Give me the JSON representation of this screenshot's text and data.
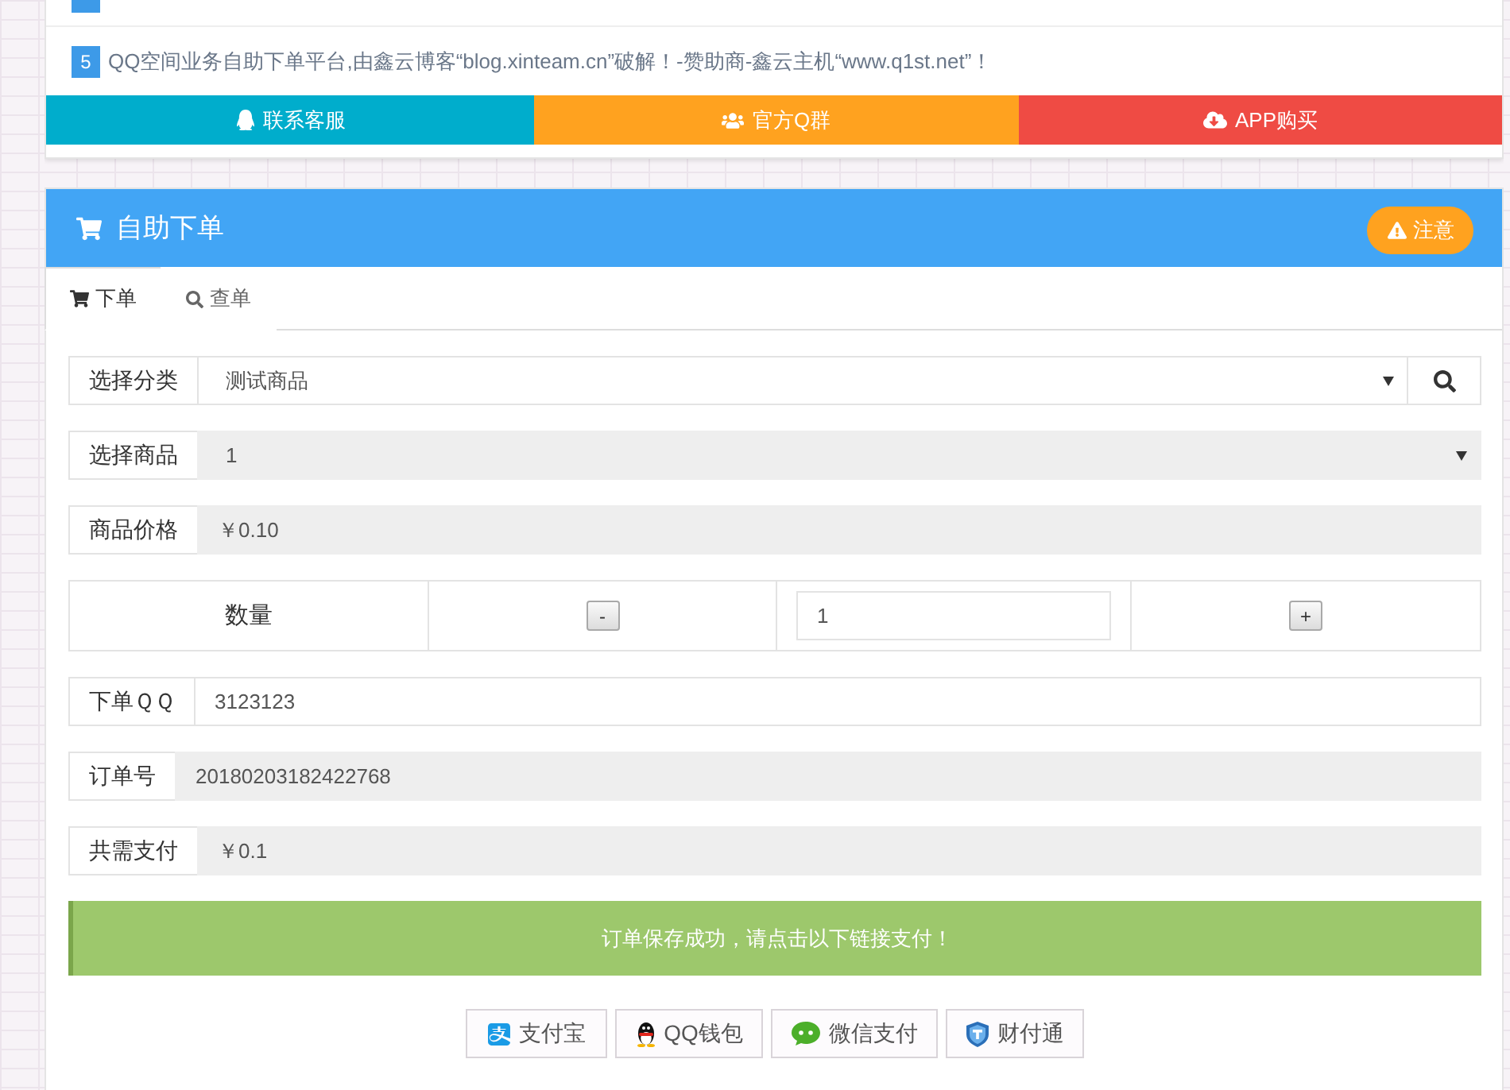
{
  "notices": [
    {
      "kind": "clipped"
    },
    {
      "kind": "full",
      "number": "5",
      "text": "QQ空间业务自助下单平台,由鑫云博客“blog.xinteam.cn”破解！-赞助商-鑫云主机“www.q1st.net”！"
    }
  ],
  "contact_buttons": [
    {
      "kind": "support",
      "label": "联系客服",
      "color": "#00adcc"
    },
    {
      "kind": "group",
      "label": "官方Q群",
      "color": "#ffa21f"
    },
    {
      "kind": "app",
      "label": "APP购买",
      "color": "#ef4b44"
    }
  ],
  "order_panel": {
    "title": "自助下单",
    "notice_button": "注意",
    "tabs": [
      {
        "kind": "order",
        "label": "下单",
        "selected": true
      },
      {
        "kind": "query",
        "label": "查单",
        "selected": false
      }
    ]
  },
  "form": {
    "fields": [
      {
        "kind": "search-select",
        "label": "选择分类",
        "value": "测试商品",
        "readonly": false
      },
      {
        "kind": "select",
        "label": "选择商品",
        "value": "1",
        "readonly": true
      },
      {
        "kind": "text",
        "label": "商品价格",
        "value": "￥0.10",
        "readonly": true
      },
      {
        "kind": "quantity",
        "label": "数量",
        "decrease": "-",
        "value": "1",
        "increase": "+",
        "readonly": false
      },
      {
        "kind": "text",
        "label": "下单ＱＱ",
        "value": "3123123",
        "readonly": false
      },
      {
        "kind": "text",
        "label": "订单号",
        "value": "20180203182422768",
        "readonly": true
      },
      {
        "kind": "text",
        "label": "共需支付",
        "value": "￥0.1",
        "readonly": true
      }
    ]
  },
  "alert": "订单保存成功，请点击以下链接支付！",
  "payment_buttons": [
    {
      "kind": "alipay",
      "label": "支付宝"
    },
    {
      "kind": "qqpay",
      "label": "QQ钱包"
    },
    {
      "kind": "wechat",
      "label": "微信支付"
    },
    {
      "kind": "tenpay",
      "label": "财付通"
    }
  ]
}
